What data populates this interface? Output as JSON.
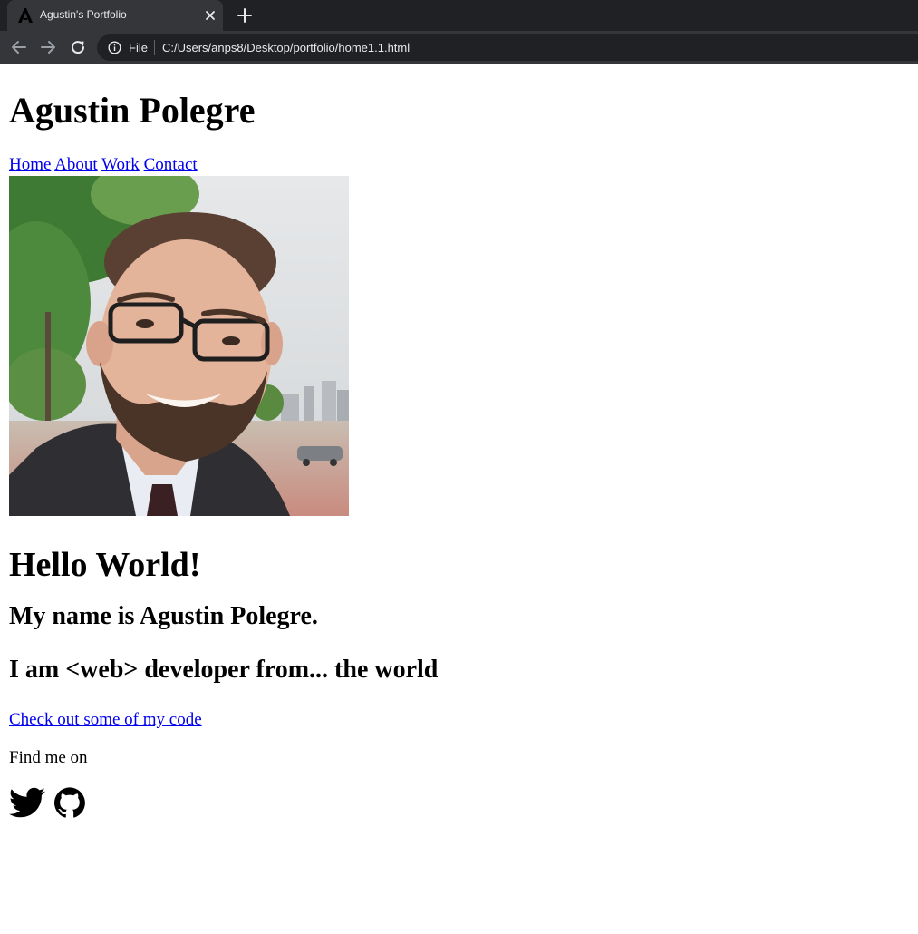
{
  "browser": {
    "tab_title": "Agustin's Portfolio",
    "omnibox": {
      "scheme_label": "File",
      "url": "C:/Users/anps8/Desktop/portfolio/home1.1.html"
    },
    "icons": [
      "site-favicon-icon",
      "close-icon",
      "plus-icon",
      "back-arrow-icon",
      "forward-arrow-icon",
      "reload-icon",
      "info-icon"
    ]
  },
  "page": {
    "title": "Agustin Polegre",
    "nav": [
      "Home",
      "About",
      "Work",
      "Contact"
    ],
    "photo_description": "portrait-photo",
    "hello": "Hello World!",
    "name_line": "My name is Agustin Polegre.",
    "dev_line": "I am <web> developer from... the world",
    "code_link": "Check out some of my code",
    "find_me": "Find me on",
    "social_icons": [
      "twitter-icon",
      "github-icon"
    ]
  },
  "colors": {
    "chrome_bg": "#35363a",
    "tabstrip_bg": "#202124",
    "link": "#0000ee"
  }
}
